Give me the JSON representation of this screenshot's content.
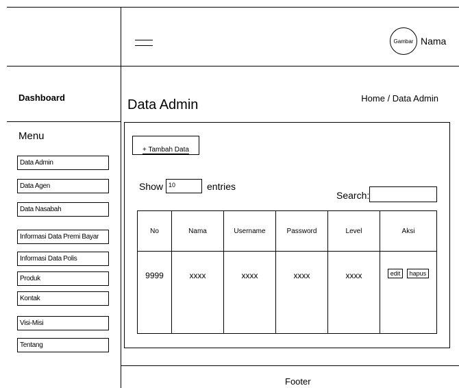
{
  "header": {
    "profile_image_label": "Gambar",
    "user_name": "Nama"
  },
  "sidebar": {
    "brand": "Dashboard",
    "menu_title": "Menu",
    "items": [
      {
        "label": "Data Admin"
      },
      {
        "label": "Data Agen"
      },
      {
        "label": "Data Nasabah"
      },
      {
        "label": "Informasi Data Premi Bayar"
      },
      {
        "label": "Informasi Data Polis"
      },
      {
        "label": "Produk"
      },
      {
        "label": "Kontak"
      },
      {
        "label": "Visi-Misi"
      },
      {
        "label": "Tentang"
      }
    ]
  },
  "main": {
    "title": "Data Admin",
    "breadcrumb": "Home / Data Admin",
    "add_button": "+ Tambah Data",
    "show_label": "Show",
    "entries_value": "10",
    "entries_label": "entries",
    "search_label": "Search:",
    "search_value": "",
    "table": {
      "headers": [
        "No",
        "Nama",
        "Username",
        "Password",
        "Level",
        "Aksi"
      ],
      "rows": [
        {
          "no": "9999",
          "nama": "xxxx",
          "username": "xxxx",
          "password": "xxxx",
          "level": "xxxx",
          "edit": "edit",
          "hapus": "hapus"
        }
      ]
    }
  },
  "footer": {
    "text": "Footer"
  }
}
